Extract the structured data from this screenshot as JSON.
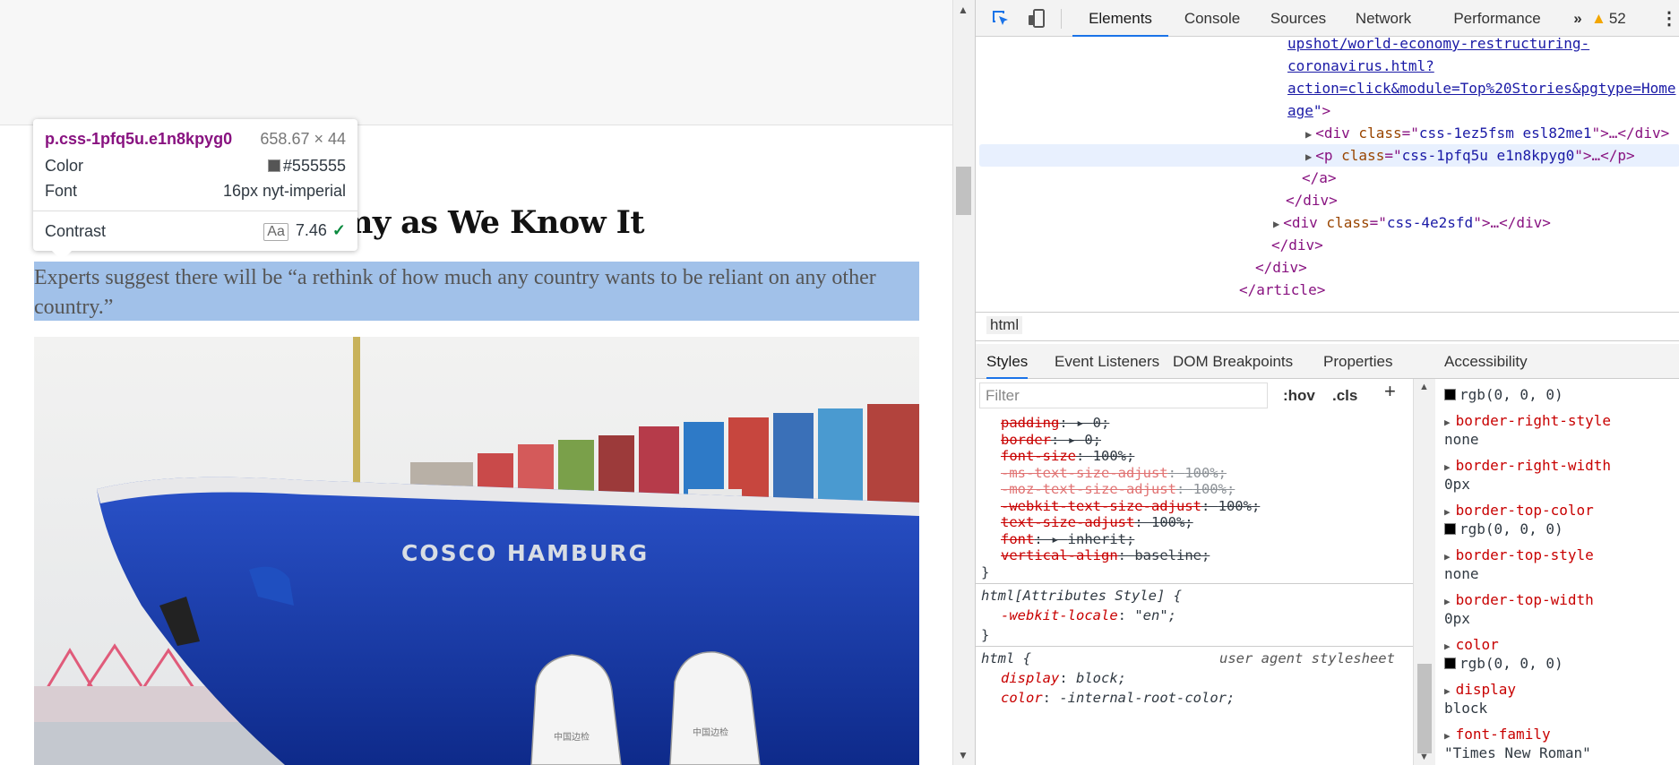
{
  "page": {
    "headline": "f the World Economy as We Know It",
    "summary": "Experts suggest there will be “a rethink of how much any country wants to be reliant on any other country.”",
    "photo_ship_name": "COSCO HAMBURG",
    "photo_suit_text": "中国边检"
  },
  "tooltip": {
    "selector": "p.css-1pfq5u.e1n8kpyg0",
    "size": "658.67 × 44",
    "color_label": "Color",
    "color_value": "#555555",
    "font_label": "Font",
    "font_value": "16px nyt-imperial",
    "contrast_label": "Contrast",
    "contrast_aa": "Aa",
    "contrast_value": "7.46",
    "contrast_check": "✓"
  },
  "devtools": {
    "tabs": [
      "Elements",
      "Console",
      "Sources",
      "Network",
      "Performance"
    ],
    "more": "»",
    "warning_count": "52",
    "dom": {
      "href_1": "upshot/world-economy-restructuring-",
      "href_2": "coronavirus.html?",
      "href_3": "action=click&module=Top%20Stories&pgtype=Home",
      "href_4": "age",
      "line_div1": {
        "tag": "div",
        "attr": "class",
        "value": "css-1ez5fsm esl82me1"
      },
      "line_p": {
        "tag": "p",
        "attr": "class",
        "value": "css-1pfq5u e1n8kpyg0"
      },
      "close_a": "</a>",
      "close_div": "</div>",
      "line_div2": {
        "tag": "div",
        "attr": "class",
        "value": "css-4e2sfd"
      },
      "close_div2": "</div>",
      "close_div3": "</div>",
      "close_article": "</article>"
    },
    "breadcrumb": "html",
    "subtabs": [
      "Styles",
      "Event Listeners",
      "DOM Breakpoints",
      "Properties",
      "Accessibility"
    ],
    "filter_placeholder": "Filter",
    "hov": ":hov",
    "cls": ".cls",
    "plus": "+",
    "styles": [
      {
        "p": "padding",
        "v": "0;",
        "arrow": true
      },
      {
        "p": "border",
        "v": "0;",
        "arrow": true
      },
      {
        "p": "font-size",
        "v": "100%;"
      },
      {
        "p": "-ms-text-size-adjust",
        "v": "100%;",
        "faded": true
      },
      {
        "p": "-moz-text-size-adjust",
        "v": "100%;",
        "faded": true
      },
      {
        "p": "-webkit-text-size-adjust",
        "v": "100%;"
      },
      {
        "p": "text-size-adjust",
        "v": "100%;"
      },
      {
        "p": "font",
        "v": "inherit;",
        "arrow": true
      },
      {
        "p": "vertical-align",
        "v": "baseline;"
      }
    ],
    "rule1_close": "}",
    "rule2_selector": "html[Attributes Style] {",
    "rule2_prop": "-webkit-locale",
    "rule2_val": "\"en\";",
    "rule2_close": "}",
    "rule3_selector": "html {",
    "rule3_source": "user agent stylesheet",
    "rule3_props": [
      {
        "p": "display",
        "v": "block;"
      },
      {
        "p": "color",
        "v": "-internal-root-color;"
      }
    ],
    "computed": [
      {
        "name": "",
        "value": "rgb(0, 0, 0)",
        "swatch": true
      },
      {
        "name": "border-right-style",
        "value": "none"
      },
      {
        "name": "border-right-width",
        "value": "0px"
      },
      {
        "name": "border-top-color",
        "value": "rgb(0, 0, 0)",
        "swatch": true
      },
      {
        "name": "border-top-style",
        "value": "none"
      },
      {
        "name": "border-top-width",
        "value": "0px"
      },
      {
        "name": "color",
        "value": "rgb(0, 0, 0)",
        "swatch": true
      },
      {
        "name": "display",
        "value": "block"
      },
      {
        "name": "font-family",
        "value": "\"Times New Roman\""
      }
    ]
  }
}
